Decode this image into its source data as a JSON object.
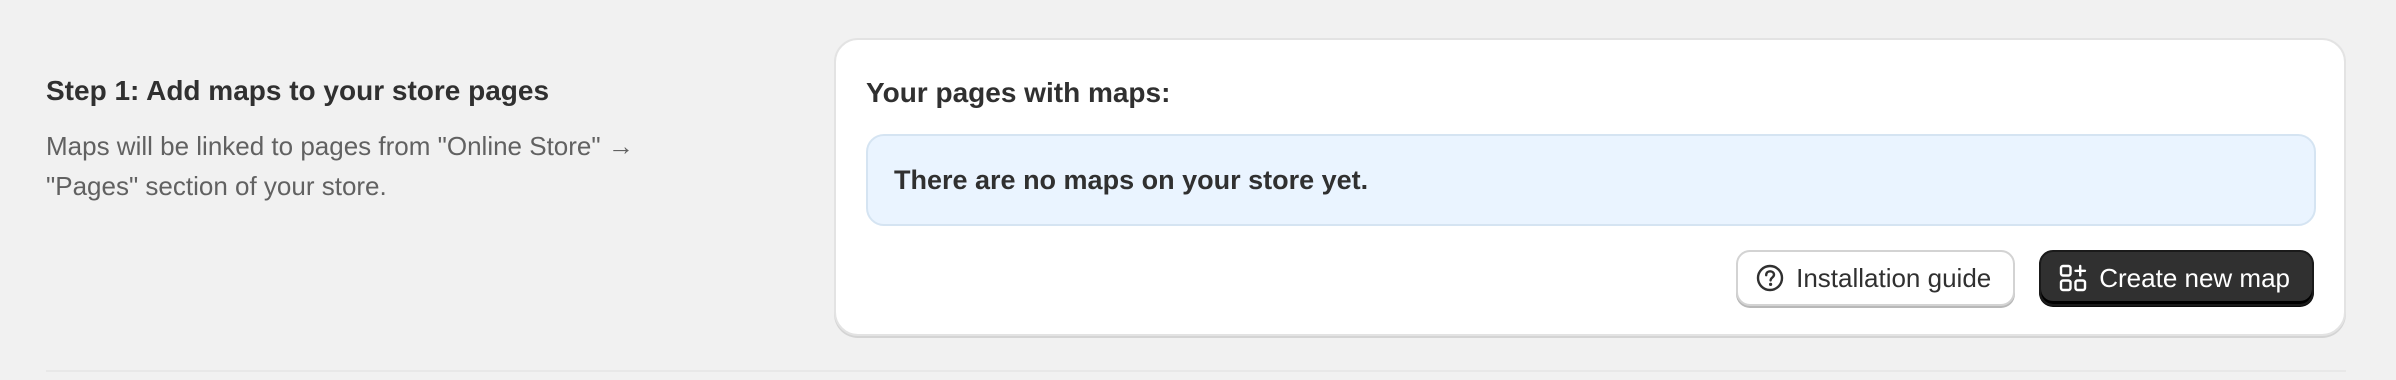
{
  "step": {
    "title": "Step 1: Add maps to your store pages",
    "description": "Maps will be linked to pages from \"Online Store\" → \"Pages\" section of your store."
  },
  "card": {
    "title": "Your pages with maps:",
    "empty_message": "There are no maps on your store yet."
  },
  "actions": {
    "installation_guide_label": "Installation guide",
    "installation_guide_icon": "question-circle-icon",
    "create_map_label": "Create new map",
    "create_map_icon": "apps-add-icon"
  },
  "colors": {
    "background": "#f1f1f1",
    "card_background": "#ffffff",
    "banner_background": "#eaf4ff",
    "primary_button": "#303030",
    "text": "#303030",
    "muted_text": "#616161"
  }
}
